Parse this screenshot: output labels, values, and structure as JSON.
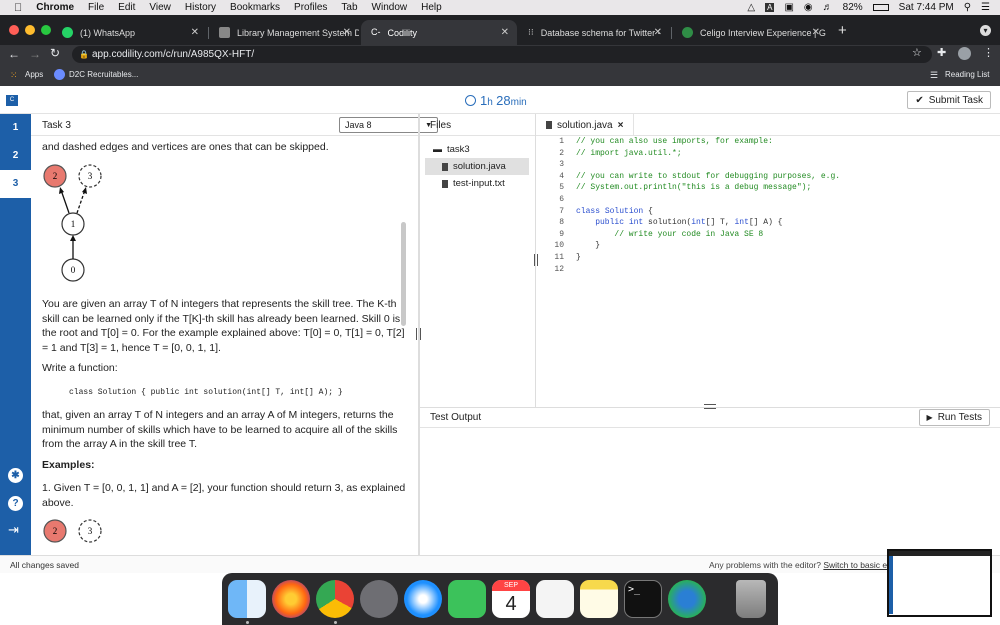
{
  "menubar": {
    "apple": "",
    "app": "Chrome",
    "items": [
      "File",
      "Edit",
      "View",
      "History",
      "Bookmarks",
      "Profiles",
      "Tab",
      "Window",
      "Help"
    ],
    "battery": "82%",
    "clock": "Sat 7:44 PM"
  },
  "tabs": [
    {
      "title": "(1) WhatsApp",
      "color": "#25d366"
    },
    {
      "title": "Library Management System D",
      "color": "#888888"
    },
    {
      "title": "Codility",
      "color": "#1d5fa8"
    },
    {
      "title": "Database schema for Twitter -",
      "color": "#cccccc"
    },
    {
      "title": "Celigo Interview Experience | G",
      "color": "#2f8d46"
    }
  ],
  "new_tab": "+",
  "address": {
    "url": "app.codility.com/c/run/A985QX-HFT/"
  },
  "bookmarks": {
    "apps": "Apps",
    "d2c": "D2C Recruitables...",
    "reading_list": "Reading List"
  },
  "header": {
    "timer_hours": "1",
    "timer_h_unit": "h",
    "timer_minutes": "28",
    "timer_min_unit": "min",
    "submit_label": "Submit Task"
  },
  "task_nav": [
    "1",
    "2",
    "3"
  ],
  "task": {
    "title": "Task 3",
    "language": "Java 8",
    "intro_fragment": "and dashed edges and vertices are ones that can be skipped.",
    "graph_nodes": [
      "2",
      "3",
      "1",
      "0"
    ],
    "para1": "You are given an array T of N integers that represents the skill tree. The K-th skill can be learned only if the T[K]-th skill has already been learned. Skill 0 is the root and T[0] = 0. For the example explained above: T[0] = 0, T[1] = 0, T[2] = 1 and T[3] = 1, hence T = [0, 0, 1, 1].",
    "write_fn": "Write a function:",
    "signature": "class Solution { public int solution(int[] T, int[] A); }",
    "para2": "that, given an array T of N integers and an array A of M integers, returns the minimum number of skills which have to be learned to acquire all of the skills from the array A in the skill tree T.",
    "examples_heading": "Examples:",
    "example1": "1. Given T = [0, 0, 1, 1] and A = [2], your function should return 3, as explained above.",
    "example_nodes": [
      "2",
      "3"
    ]
  },
  "files": {
    "header": "Files",
    "folder": "task3",
    "items": [
      "solution.java",
      "test-input.txt"
    ]
  },
  "editor": {
    "tab": "solution.java",
    "close": "×",
    "line_numbers": [
      "1",
      "2",
      "3",
      "4",
      "5",
      "6",
      "7",
      "8",
      "9",
      "10",
      "11",
      "12"
    ]
  },
  "test_output": {
    "header": "Test Output",
    "run_label": "Run Tests"
  },
  "status": {
    "saved": "All changes saved",
    "problems": "Any problems with the editor?",
    "basic_link": "Switch to basic editor"
  },
  "dock": {
    "calendar_month": "SEP",
    "calendar_day": "4"
  },
  "colors": {
    "codility_blue": "#1d5fa8",
    "timer_blue": "#2a6ebb",
    "node_highlight": "#e8796f"
  }
}
